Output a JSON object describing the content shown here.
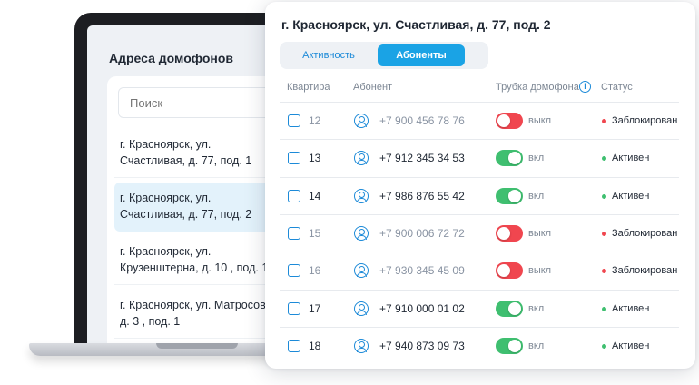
{
  "laptop": {
    "title": "Адреса домофонов",
    "search": {
      "placeholder": "Поиск"
    },
    "addresses": [
      {
        "line1": "г. Красноярск, ул.",
        "line2": "Счастливая, д. 77, под. 1"
      },
      {
        "line1": "г. Красноярск, ул.",
        "line2": "Счастливая, д. 77, под. 2"
      },
      {
        "line1": "г. Красноярск, ул.",
        "line2": "Крузенштерна, д. 10 , под. 1"
      },
      {
        "line1": "г. Красноярск, ул. Матросов,",
        "line2": "д. 3 , под. 1"
      }
    ],
    "selected_index": 1
  },
  "card": {
    "title": "г. Красноярск, ул. Счастливая, д. 77, под. 2",
    "tabs": [
      {
        "label": "Активность",
        "active": false
      },
      {
        "label": "Абоненты",
        "active": true
      }
    ],
    "columns": {
      "apartment": "Квартира",
      "subscriber": "Абонент",
      "handset": "Трубка домофона",
      "status": "Статус"
    },
    "info_icon": "i",
    "rows": [
      {
        "apartment": "12",
        "phone": "+7 900 456 78 76",
        "handset": "выкл",
        "handset_on": false,
        "status": "Заблокирован"
      },
      {
        "apartment": "13",
        "phone": "+7 912 345 34 53",
        "handset": "вкл",
        "handset_on": true,
        "status": "Активен"
      },
      {
        "apartment": "14",
        "phone": "+7 986 876 55 42",
        "handset": "вкл",
        "handset_on": true,
        "status": "Активен"
      },
      {
        "apartment": "15",
        "phone": "+7 900 006 72 72",
        "handset": "выкл",
        "handset_on": false,
        "status": "Заблокирован"
      },
      {
        "apartment": "16",
        "phone": "+7 930 345 45 09",
        "handset": "выкл",
        "handset_on": false,
        "status": "Заблокирован"
      },
      {
        "apartment": "17",
        "phone": "+7 910 000 01 02",
        "handset": "вкл",
        "handset_on": true,
        "status": "Активен"
      },
      {
        "apartment": "18",
        "phone": "+7 940 873 09 73",
        "handset": "вкл",
        "handset_on": true,
        "status": "Активен"
      }
    ]
  },
  "colors": {
    "accent": "#1aa3e5",
    "on": "#3fbf70",
    "off": "#f0464f",
    "blocked_dot": "#f0464f",
    "active_dot": "#3fbf70"
  }
}
